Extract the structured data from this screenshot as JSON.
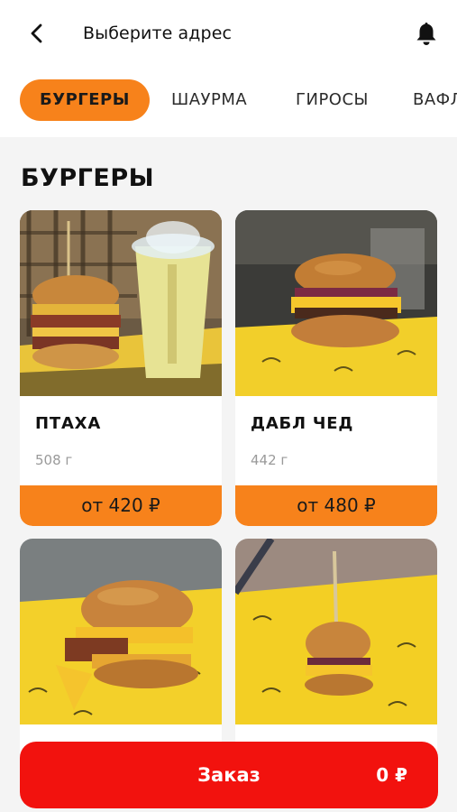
{
  "header": {
    "title": "Выберите адрес",
    "back_icon": "chevron-left-icon",
    "notify_icon": "bell-icon"
  },
  "tabs": [
    {
      "label": "БУРГЕРЫ",
      "active": true
    },
    {
      "label": "ШАУРМА",
      "active": false
    },
    {
      "label": "ГИРОСЫ",
      "active": false
    },
    {
      "label": "ВАФЛИ",
      "active": false
    }
  ],
  "section": {
    "title": "БУРГЕРЫ"
  },
  "products": [
    {
      "name": "ПТАХА",
      "weight": "508 г",
      "price": "от 420 ₽"
    },
    {
      "name": "ДАБЛ ЧЕД",
      "weight": "442 г",
      "price": "от 480 ₽"
    },
    {
      "name": "",
      "weight": "",
      "price": ""
    },
    {
      "name": "",
      "weight": "",
      "price": ""
    }
  ],
  "order": {
    "label": "Заказ",
    "total": "0 ₽"
  },
  "colors": {
    "accent": "#f7821b",
    "order": "#f2120e",
    "paper": "#f6d21c"
  }
}
